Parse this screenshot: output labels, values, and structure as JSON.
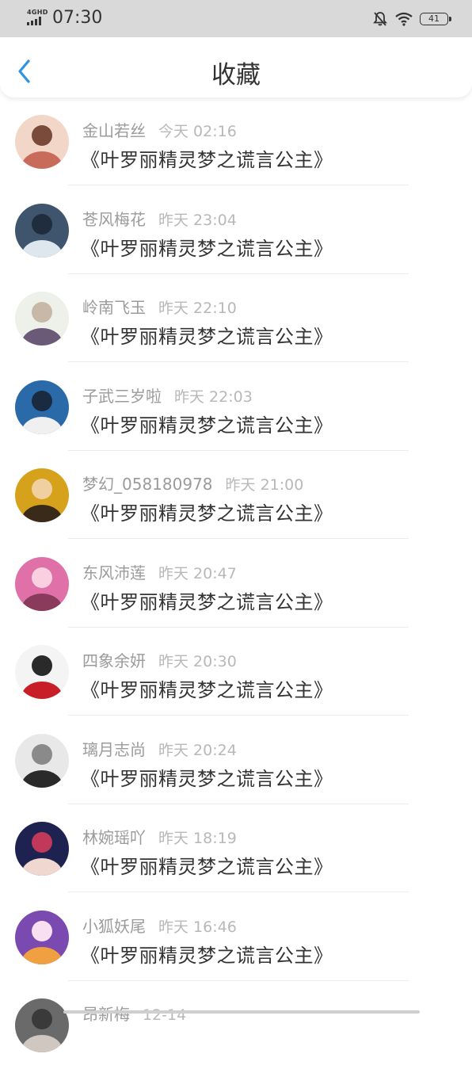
{
  "status_bar": {
    "network": "4GHD",
    "time": "07:30",
    "battery": "41"
  },
  "header": {
    "title": "收藏"
  },
  "items": [
    {
      "name": "金山若丝",
      "time": "今天 02:16",
      "book": "《叶罗丽精灵梦之谎言公主》",
      "avatar_colors": [
        "#f2d7c9",
        "#c96b5a",
        "#7a4a3a"
      ]
    },
    {
      "name": "苍风梅花",
      "time": "昨天 23:04",
      "book": "《叶罗丽精灵梦之谎言公主》",
      "avatar_colors": [
        "#3f556e",
        "#dfe7ee",
        "#1f2d3d"
      ]
    },
    {
      "name": "岭南飞玉",
      "time": "昨天 22:10",
      "book": "《叶罗丽精灵梦之谎言公主》",
      "avatar_colors": [
        "#eef0ea",
        "#6a5a78",
        "#c8b8a8"
      ]
    },
    {
      "name": "子武三岁啦",
      "time": "昨天 22:03",
      "book": "《叶罗丽精灵梦之谎言公主》",
      "avatar_colors": [
        "#2b6aa8",
        "#f0f0f0",
        "#1a2a40"
      ]
    },
    {
      "name": "梦幻_058180978",
      "time": "昨天 21:00",
      "book": "《叶罗丽精灵梦之谎言公主》",
      "avatar_colors": [
        "#d6a21c",
        "#3a2a1a",
        "#f0d0a0"
      ]
    },
    {
      "name": "东风沛莲",
      "time": "昨天 20:47",
      "book": "《叶罗丽精灵梦之谎言公主》",
      "avatar_colors": [
        "#e070a8",
        "#8a3a5a",
        "#f8d0e0"
      ]
    },
    {
      "name": "四象余妍",
      "time": "昨天 20:30",
      "book": "《叶罗丽精灵梦之谎言公主》",
      "avatar_colors": [
        "#f4f4f4",
        "#c81e28",
        "#2a2a2a"
      ]
    },
    {
      "name": "璃月志尚",
      "time": "昨天 20:24",
      "book": "《叶罗丽精灵梦之谎言公主》",
      "avatar_colors": [
        "#e8e8e8",
        "#2a2a2a",
        "#8a8a8a"
      ]
    },
    {
      "name": "林婉瑶吖",
      "time": "昨天 18:19",
      "book": "《叶罗丽精灵梦之谎言公主》",
      "avatar_colors": [
        "#1e2250",
        "#f0d8d0",
        "#c0385a"
      ]
    },
    {
      "name": "小狐妖尾",
      "time": "昨天 16:46",
      "book": "《叶罗丽精灵梦之谎言公主》",
      "avatar_colors": [
        "#7a4ab0",
        "#f0a040",
        "#f8e0f0"
      ]
    },
    {
      "name": "昂新梅",
      "time": "12-14",
      "book": "",
      "avatar_colors": [
        "#6a6a6a",
        "#d0c8c0",
        "#3a3a3a"
      ]
    }
  ]
}
